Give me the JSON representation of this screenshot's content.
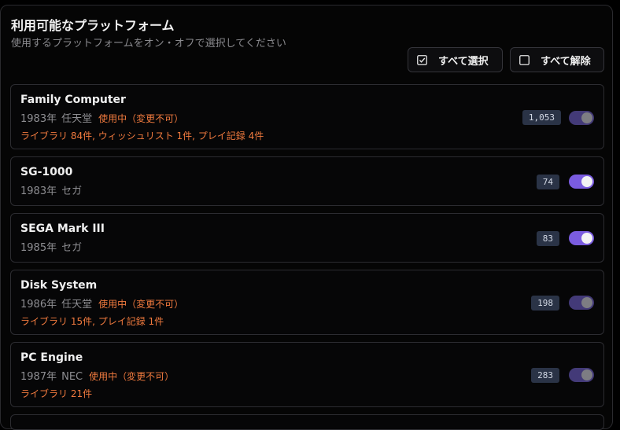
{
  "header": {
    "title": "利用可能なプラットフォーム",
    "subtitle": "使用するプラットフォームをオン・オフで選択してください"
  },
  "toolbar": {
    "select_all_label": "すべて選択",
    "deselect_all_label": "すべて解除"
  },
  "platforms": [
    {
      "name": "Family Computer",
      "year": "1983年",
      "maker": "任天堂",
      "in_use": "使用中（変更不可）",
      "usage": "ライブラリ 84件, ウィッシュリスト 1件, プレイ記録 4件",
      "count": "1,053",
      "enabled": true,
      "locked": true
    },
    {
      "name": "SG-1000",
      "year": "1983年",
      "maker": "セガ",
      "count": "74",
      "enabled": true,
      "locked": false
    },
    {
      "name": "SEGA Mark III",
      "year": "1985年",
      "maker": "セガ",
      "count": "83",
      "enabled": true,
      "locked": false
    },
    {
      "name": "Disk System",
      "year": "1986年",
      "maker": "任天堂",
      "in_use": "使用中（変更不可）",
      "usage": "ライブラリ 15件, プレイ記録 1件",
      "count": "198",
      "enabled": true,
      "locked": true
    },
    {
      "name": "PC Engine",
      "year": "1987年",
      "maker": "NEC",
      "in_use": "使用中（変更不可）",
      "usage": "ライブラリ 21件",
      "count": "283",
      "enabled": true,
      "locked": true
    }
  ],
  "colors": {
    "accent": "#7a5ce0",
    "locked_track": "#433a78",
    "warning": "#f07a3e",
    "count_badge": "#2a3346"
  }
}
